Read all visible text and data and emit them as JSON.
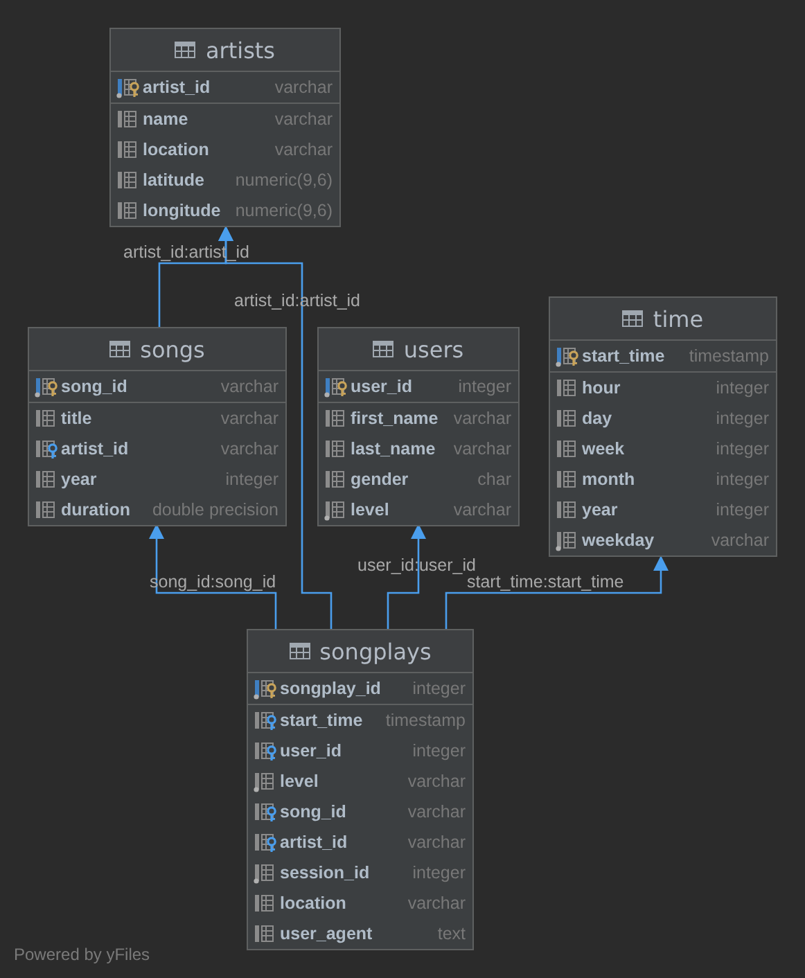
{
  "tables": [
    {
      "name": "artists",
      "columns": [
        {
          "name": "artist_id",
          "type": "varchar",
          "kind": "pk",
          "not_null": true
        },
        {
          "name": "name",
          "type": "varchar",
          "kind": "column",
          "not_null": false
        },
        {
          "name": "location",
          "type": "varchar",
          "kind": "column",
          "not_null": false
        },
        {
          "name": "latitude",
          "type": "numeric(9,6)",
          "kind": "column",
          "not_null": false
        },
        {
          "name": "longitude",
          "type": "numeric(9,6)",
          "kind": "column",
          "not_null": false
        }
      ]
    },
    {
      "name": "songs",
      "columns": [
        {
          "name": "song_id",
          "type": "varchar",
          "kind": "pk",
          "not_null": true
        },
        {
          "name": "title",
          "type": "varchar",
          "kind": "column",
          "not_null": false
        },
        {
          "name": "artist_id",
          "type": "varchar",
          "kind": "fk",
          "not_null": false
        },
        {
          "name": "year",
          "type": "integer",
          "kind": "column",
          "not_null": false
        },
        {
          "name": "duration",
          "type": "double precision",
          "kind": "column",
          "not_null": false
        }
      ]
    },
    {
      "name": "users",
      "columns": [
        {
          "name": "user_id",
          "type": "integer",
          "kind": "pk",
          "not_null": true
        },
        {
          "name": "first_name",
          "type": "varchar",
          "kind": "column",
          "not_null": false
        },
        {
          "name": "last_name",
          "type": "varchar",
          "kind": "column",
          "not_null": false
        },
        {
          "name": "gender",
          "type": "char",
          "kind": "column",
          "not_null": false
        },
        {
          "name": "level",
          "type": "varchar",
          "kind": "column",
          "not_null": true
        }
      ]
    },
    {
      "name": "time",
      "columns": [
        {
          "name": "start_time",
          "type": "timestamp",
          "kind": "pk",
          "not_null": true
        },
        {
          "name": "hour",
          "type": "integer",
          "kind": "column",
          "not_null": false
        },
        {
          "name": "day",
          "type": "integer",
          "kind": "column",
          "not_null": false
        },
        {
          "name": "week",
          "type": "integer",
          "kind": "column",
          "not_null": false
        },
        {
          "name": "month",
          "type": "integer",
          "kind": "column",
          "not_null": false
        },
        {
          "name": "year",
          "type": "integer",
          "kind": "column",
          "not_null": false
        },
        {
          "name": "weekday",
          "type": "varchar",
          "kind": "column",
          "not_null": true
        }
      ]
    },
    {
      "name": "songplays",
      "columns": [
        {
          "name": "songplay_id",
          "type": "integer",
          "kind": "pk",
          "not_null": true
        },
        {
          "name": "start_time",
          "type": "timestamp",
          "kind": "fk",
          "not_null": false
        },
        {
          "name": "user_id",
          "type": "integer",
          "kind": "fk",
          "not_null": false
        },
        {
          "name": "level",
          "type": "varchar",
          "kind": "column",
          "not_null": true
        },
        {
          "name": "song_id",
          "type": "varchar",
          "kind": "fk",
          "not_null": false
        },
        {
          "name": "artist_id",
          "type": "varchar",
          "kind": "fk",
          "not_null": false
        },
        {
          "name": "session_id",
          "type": "integer",
          "kind": "column",
          "not_null": true
        },
        {
          "name": "location",
          "type": "varchar",
          "kind": "column",
          "not_null": false
        },
        {
          "name": "user_agent",
          "type": "text",
          "kind": "column",
          "not_null": false
        }
      ]
    }
  ],
  "relationships": [
    {
      "label": "artist_id:artist_id"
    },
    {
      "label": "artist_id:artist_id"
    },
    {
      "label": "song_id:song_id"
    },
    {
      "label": "user_id:user_id"
    },
    {
      "label": "start_time:start_time"
    }
  ],
  "footer": "Powered by yFiles"
}
